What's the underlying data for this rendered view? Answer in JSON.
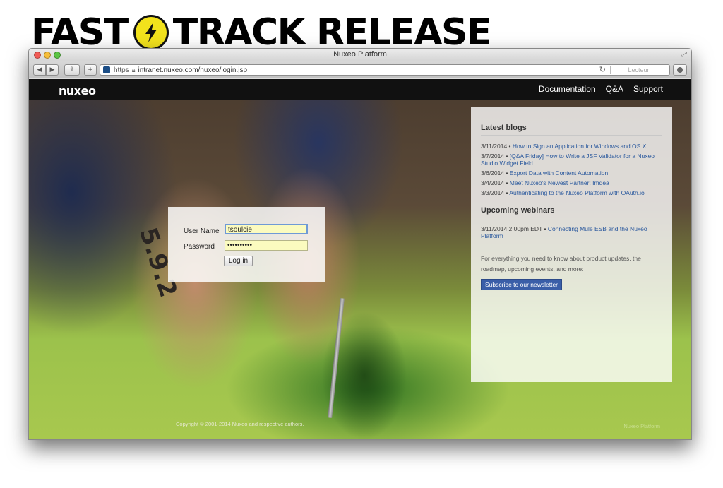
{
  "banner": {
    "word1": "FAST",
    "word2": "TRACK RELEASE"
  },
  "browser": {
    "window_title": "Nuxeo Platform",
    "url_scheme": "https",
    "url": "intranet.nuxeo.com/nuxeo/login.jsp",
    "reader_label": "Lecteur"
  },
  "site": {
    "logo": "nuxeo",
    "nav": [
      "Documentation",
      "Q&A",
      "Support"
    ]
  },
  "login": {
    "username_label": "User Name",
    "username_value": "tsoulcie",
    "password_label": "Password",
    "password_value": "••••••••••",
    "submit_label": "Log in"
  },
  "photo": {
    "tattoo_text": "5.9.2"
  },
  "sidebar": {
    "blogs_heading": "Latest blogs",
    "blogs": [
      {
        "date": "3/11/2014",
        "title": "How to Sign an Application for Windows and OS X"
      },
      {
        "date": "3/7/2014",
        "title": "[Q&A Friday] How to Write a JSF Validator for a Nuxeo Studio Widget Field"
      },
      {
        "date": "3/6/2014",
        "title": "Export Data with Content Automation"
      },
      {
        "date": "3/4/2014",
        "title": "Meet Nuxeo's Newest Partner: Imdea"
      },
      {
        "date": "3/3/2014",
        "title": "Authenticating to the Nuxeo Platform with OAuth.io"
      }
    ],
    "webinars_heading": "Upcoming webinars",
    "webinar": {
      "date": "3/11/2014 2:00pm EDT",
      "title": "Connecting Mule ESB and the Nuxeo Platform"
    },
    "promo_text": "For everything you need to know about product updates, the roadmap, upcoming events, and more:",
    "subscribe_label": "Subscribe to our newsletter"
  },
  "footer": {
    "copyright": "Copyright © 2001-2014 Nuxeo and respective authors.",
    "version": "Nuxeo Platform"
  }
}
